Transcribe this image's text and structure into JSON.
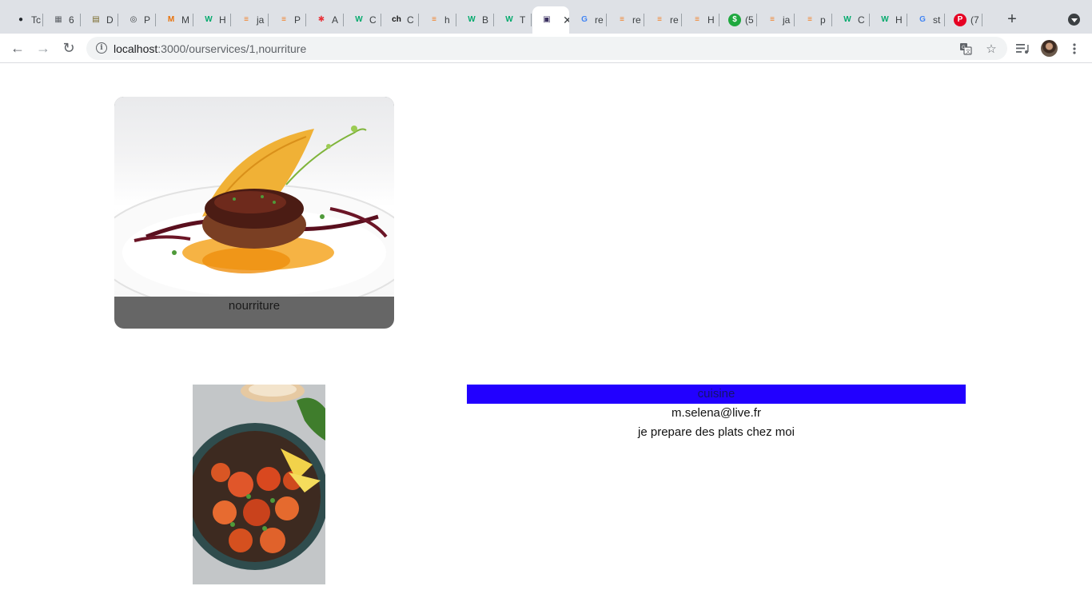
{
  "browser": {
    "tabs": [
      {
        "label": "Tc",
        "icon": "github-icon",
        "color": "#24292e"
      },
      {
        "label": "6",
        "icon": "table-icon",
        "color": "#5f6368"
      },
      {
        "label": "D",
        "icon": "document-icon",
        "color": "#7a6a2a"
      },
      {
        "label": "P",
        "icon": "globe-icon",
        "color": "#3c4043"
      },
      {
        "label": "M",
        "icon": "m-logo-icon",
        "color": "#e8710a"
      },
      {
        "label": "H",
        "icon": "w3schools-icon",
        "color": "#04aa6d"
      },
      {
        "label": "ja",
        "icon": "stackoverflow-icon",
        "color": "#f48024"
      },
      {
        "label": "P",
        "icon": "stackoverflow-icon",
        "color": "#f48024"
      },
      {
        "label": "A",
        "icon": "asterisk-icon",
        "color": "#e8333a"
      },
      {
        "label": "C",
        "icon": "w3schools-icon",
        "color": "#04aa6d"
      },
      {
        "label": "C",
        "icon": "ch-text-icon",
        "color": "#111111"
      },
      {
        "label": "h",
        "icon": "stackoverflow-icon",
        "color": "#f48024"
      },
      {
        "label": "B",
        "icon": "w3schools-icon",
        "color": "#04aa6d"
      },
      {
        "label": "T",
        "icon": "w3schools-icon",
        "color": "#04aa6d"
      },
      {
        "label": "",
        "icon": "app-thumbnail-icon",
        "color": "#3a3060",
        "active": true
      },
      {
        "label": "re",
        "icon": "google-icon",
        "color": "#4285f4"
      },
      {
        "label": "re",
        "icon": "stackoverflow-icon",
        "color": "#f48024"
      },
      {
        "label": "re",
        "icon": "stackoverflow-icon",
        "color": "#f48024"
      },
      {
        "label": "H",
        "icon": "stackoverflow-icon",
        "color": "#f48024"
      },
      {
        "label": "(5",
        "icon": "dollar-icon",
        "color": "#1fa83f"
      },
      {
        "label": "ja",
        "icon": "stackoverflow-icon",
        "color": "#f48024"
      },
      {
        "label": "p",
        "icon": "stackoverflow-icon",
        "color": "#f48024"
      },
      {
        "label": "C",
        "icon": "w3schools-icon",
        "color": "#04aa6d"
      },
      {
        "label": "H",
        "icon": "w3schools-icon",
        "color": "#04aa6d"
      },
      {
        "label": "st",
        "icon": "google-icon",
        "color": "#4285f4"
      },
      {
        "label": "(7",
        "icon": "pinterest-icon",
        "color": "#e60023"
      }
    ],
    "url_host": "localhost",
    "url_path": ":3000/ourservices/1,nourriture"
  },
  "page": {
    "card_label": "nourriture",
    "service": {
      "category": "cuisine",
      "email": "m.selena@live.fr",
      "description": "je prepare des plats chez moi"
    }
  },
  "colors": {
    "category_bar": "#2200ff",
    "card_caption_bg": "#666666"
  }
}
